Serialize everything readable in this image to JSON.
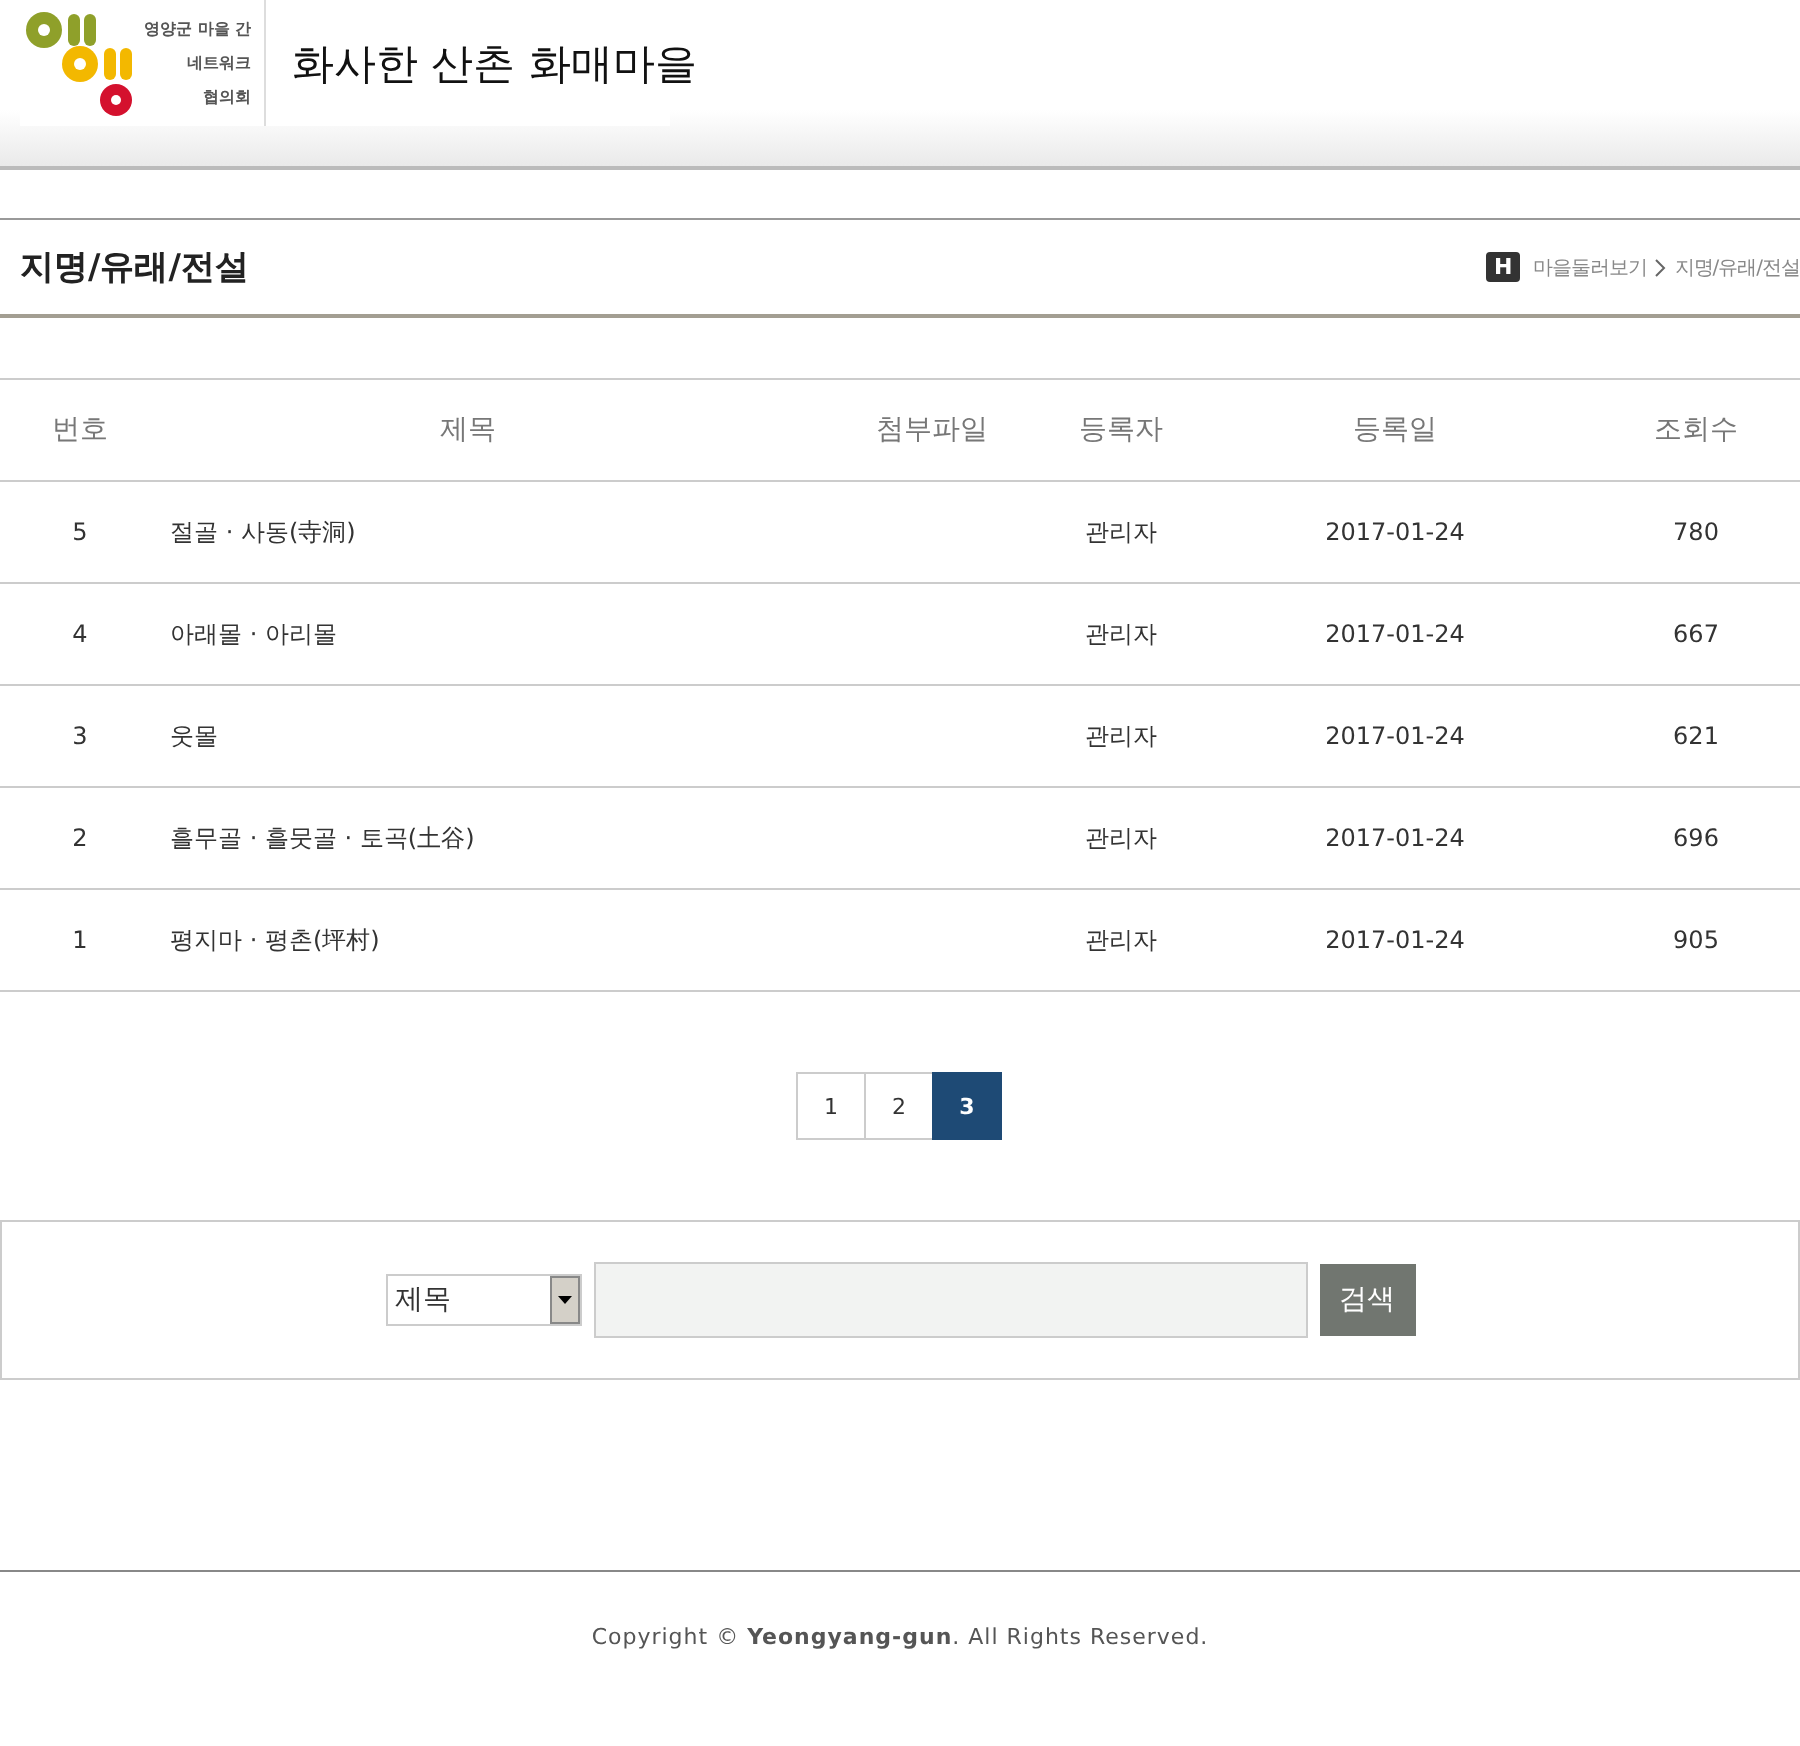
{
  "header": {
    "logo_lines": [
      "영양군 마을 간",
      "네트워크",
      "협의회"
    ],
    "site_title": "화사한 산촌 화매마을"
  },
  "page": {
    "title": "지명/유래/전설",
    "breadcrumb_home": "H",
    "breadcrumb": [
      "마을둘러보기",
      "지명/유래/전설"
    ]
  },
  "table": {
    "columns": [
      "번호",
      "제목",
      "첨부파일",
      "등록자",
      "등록일",
      "조회수"
    ],
    "rows": [
      {
        "number": "5",
        "title": "절골 · 사동(寺洞)",
        "author": "관리자",
        "date": "2017-01-24",
        "views": "780"
      },
      {
        "number": "4",
        "title": "아래몰 · 아리몰",
        "author": "관리자",
        "date": "2017-01-24",
        "views": "667"
      },
      {
        "number": "3",
        "title": "웃몰",
        "author": "관리자",
        "date": "2017-01-24",
        "views": "621"
      },
      {
        "number": "2",
        "title": "흘무골 · 흘뭇골 · 토곡(土谷)",
        "author": "관리자",
        "date": "2017-01-24",
        "views": "696"
      },
      {
        "number": "1",
        "title": "평지마 · 평촌(坪村)",
        "author": "관리자",
        "date": "2017-01-24",
        "views": "905"
      }
    ]
  },
  "pagination": [
    {
      "label": "1",
      "selected": false
    },
    {
      "label": "2",
      "selected": false
    },
    {
      "label": "3",
      "selected": true
    }
  ],
  "search": {
    "field_select": "제목",
    "button": "검색"
  },
  "footer": {
    "copyright": "Copyright © **Yeongyang-gun**. All Rights Reserved."
  }
}
